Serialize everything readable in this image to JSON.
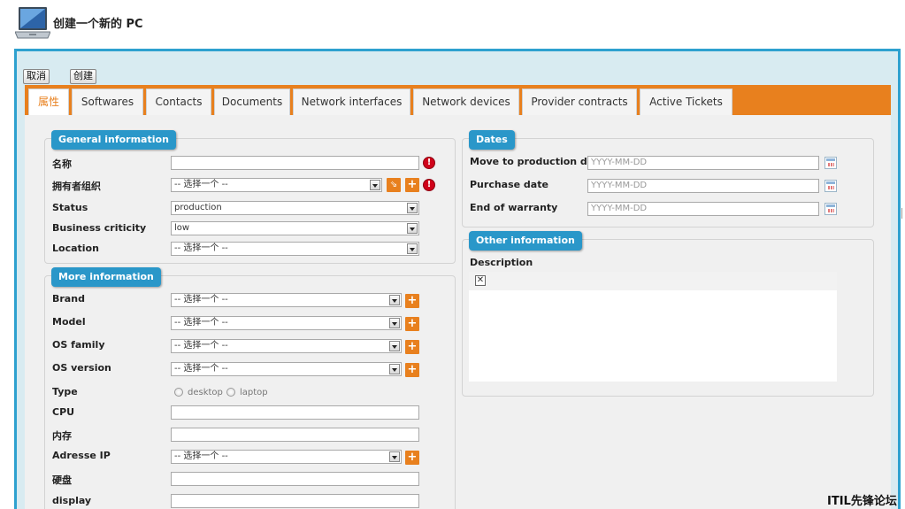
{
  "header": {
    "title": "创建一个新的 PC"
  },
  "toolbar": {
    "cancel_label": "取消",
    "create_label": "创建"
  },
  "tabs": [
    {
      "label": "属性"
    },
    {
      "label": "Softwares"
    },
    {
      "label": "Contacts"
    },
    {
      "label": "Documents"
    },
    {
      "label": "Network interfaces"
    },
    {
      "label": "Network devices"
    },
    {
      "label": "Provider contracts"
    },
    {
      "label": "Active Tickets"
    }
  ],
  "active_tab": "属性",
  "general": {
    "legend": "General information",
    "name_label": "名称",
    "name_value": "",
    "org_label": "拥有者组织",
    "org_value": "-- 选择一个 --",
    "status_label": "Status",
    "status_value": "production",
    "criticity_label": "Business criticity",
    "criticity_value": "low",
    "location_label": "Location",
    "location_value": "-- 选择一个 --"
  },
  "more": {
    "legend": "More information",
    "brand_label": "Brand",
    "brand_value": "-- 选择一个 --",
    "model_label": "Model",
    "model_value": "-- 选择一个 --",
    "osfamily_label": "OS family",
    "osfamily_value": "-- 选择一个 --",
    "osversion_label": "OS version",
    "osversion_value": "-- 选择一个 --",
    "type_label": "Type",
    "type_option1": "desktop",
    "type_option2": "laptop",
    "cpu_label": "CPU",
    "ram_label": "内存",
    "ip_label": "Adresse IP",
    "ip_value": "-- 选择一个 --",
    "disk_label": "硬盘",
    "display_label": "display"
  },
  "dates": {
    "legend": "Dates",
    "production_label": "Move to production date",
    "purchase_label": "Purchase date",
    "warranty_label": "End of warranty",
    "placeholder": "YYYY-MM-DD"
  },
  "other": {
    "legend": "Other information",
    "description_label": "Description"
  },
  "watermark": "ITIL先锋论坛",
  "colors": {
    "accent_orange": "#e8801e",
    "accent_blue": "#2a97c9",
    "frame_blue": "#2ea1cf",
    "required_red": "#d0021b"
  }
}
